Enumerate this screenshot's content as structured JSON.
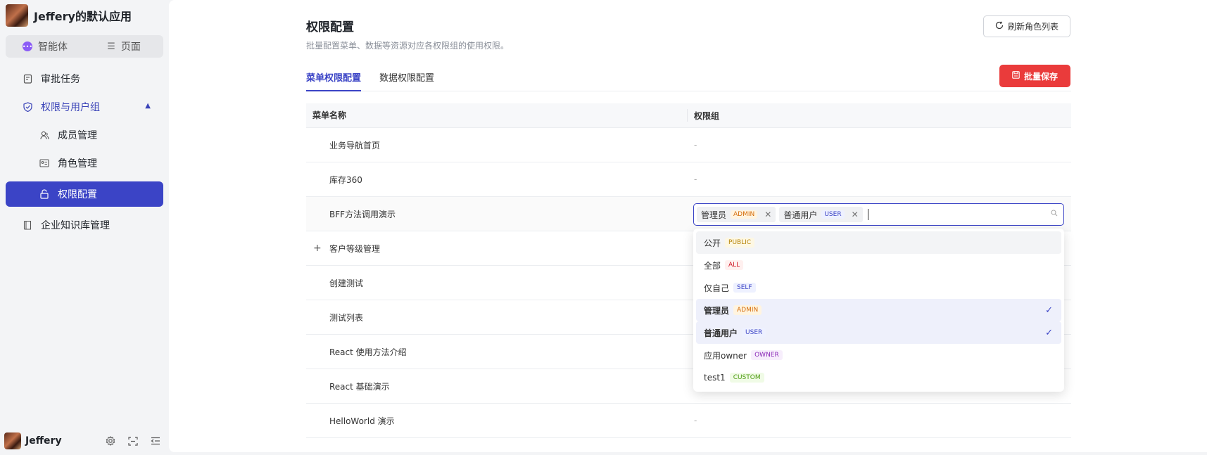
{
  "app": {
    "title": "Jeffery的默认应用"
  },
  "mode_switch": {
    "agent_label": "智能体",
    "page_label": "页面"
  },
  "sidebar": {
    "items": [
      {
        "label": "审批任务",
        "icon": "clipboard-icon"
      },
      {
        "label": "权限与用户组",
        "icon": "shield-icon"
      },
      {
        "label": "成员管理",
        "icon": "users-icon"
      },
      {
        "label": "角色管理",
        "icon": "id-card-icon"
      },
      {
        "label": "权限配置",
        "icon": "lock-icon"
      },
      {
        "label": "企业知识库管理",
        "icon": "book-icon"
      }
    ]
  },
  "footer": {
    "user_name": "Jeffery"
  },
  "page": {
    "title": "权限配置",
    "description": "批量配置菜单、数据等资源对应各权限组的使用权限。",
    "refresh_label": "刷新角色列表",
    "save_label": "批量保存"
  },
  "tabs": [
    {
      "label": "菜单权限配置",
      "active": true
    },
    {
      "label": "数据权限配置",
      "active": false
    }
  ],
  "table": {
    "columns": [
      "菜单名称",
      "权限组"
    ],
    "rows": [
      {
        "name": "业务导航首页",
        "groups": "-"
      },
      {
        "name": "库存360",
        "groups": "-"
      },
      {
        "name": "BFF方法调用演示",
        "groups": ""
      },
      {
        "name": "客户等级管理",
        "groups": ""
      },
      {
        "name": "创建测试",
        "groups": ""
      },
      {
        "name": "测试列表",
        "groups": ""
      },
      {
        "name": "React 使用方法介绍",
        "groups": ""
      },
      {
        "name": "React 基础演示",
        "groups": ""
      },
      {
        "name": "HelloWorld 演示",
        "groups": "-"
      }
    ]
  },
  "select": {
    "tags": [
      {
        "label": "管理员",
        "code": "ADMIN"
      },
      {
        "label": "普通用户",
        "code": "USER"
      }
    ]
  },
  "options": [
    {
      "label": "公开",
      "code": "PUBLIC",
      "selected": false
    },
    {
      "label": "全部",
      "code": "ALL",
      "selected": false
    },
    {
      "label": "仅自己",
      "code": "SELF",
      "selected": false
    },
    {
      "label": "管理员",
      "code": "ADMIN",
      "selected": true
    },
    {
      "label": "普通用户",
      "code": "USER",
      "selected": true
    },
    {
      "label": "应用owner",
      "code": "OWNER",
      "selected": false
    },
    {
      "label": "test1",
      "code": "CUSTOM",
      "selected": false
    }
  ],
  "colors": {
    "accent": "#3b44c6",
    "danger": "#ea3b3b"
  }
}
